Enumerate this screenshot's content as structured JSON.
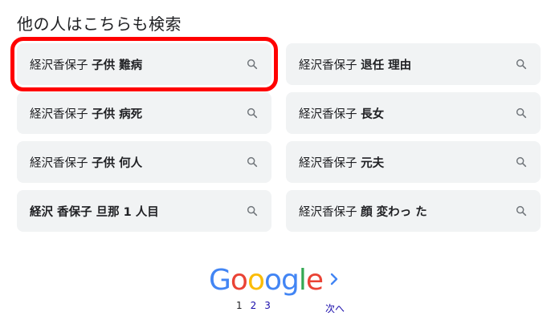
{
  "heading": "他の人はこちらも検索",
  "chips": [
    {
      "prefix": "経沢香保子",
      "bold": "子供 難病"
    },
    {
      "prefix": "経沢香保子",
      "bold": "退任 理由"
    },
    {
      "prefix": "経沢香保子",
      "bold": "子供 病死"
    },
    {
      "prefix": "経沢香保子",
      "bold": "長女"
    },
    {
      "prefix": "経沢香保子",
      "bold": "子供 何人"
    },
    {
      "prefix": "経沢香保子",
      "bold": "元夫"
    },
    {
      "prefix": "",
      "bold": "経沢 香保子 旦那 1 人目"
    },
    {
      "prefix": "経沢香保子",
      "bold": "顔 変わっ た"
    }
  ],
  "highlight_color": "#ff0000",
  "pagination": {
    "logo_letters": [
      "G",
      "o",
      "o",
      "o",
      "g",
      "l",
      "e"
    ],
    "logo_colors": [
      "#4285f4",
      "#ea4335",
      "#fbbc05",
      "#4285f4",
      "#4285f4",
      "#34a853",
      "#ea4335"
    ],
    "current_page": "1",
    "pages": [
      "2",
      "3"
    ],
    "next_label": "次へ"
  }
}
